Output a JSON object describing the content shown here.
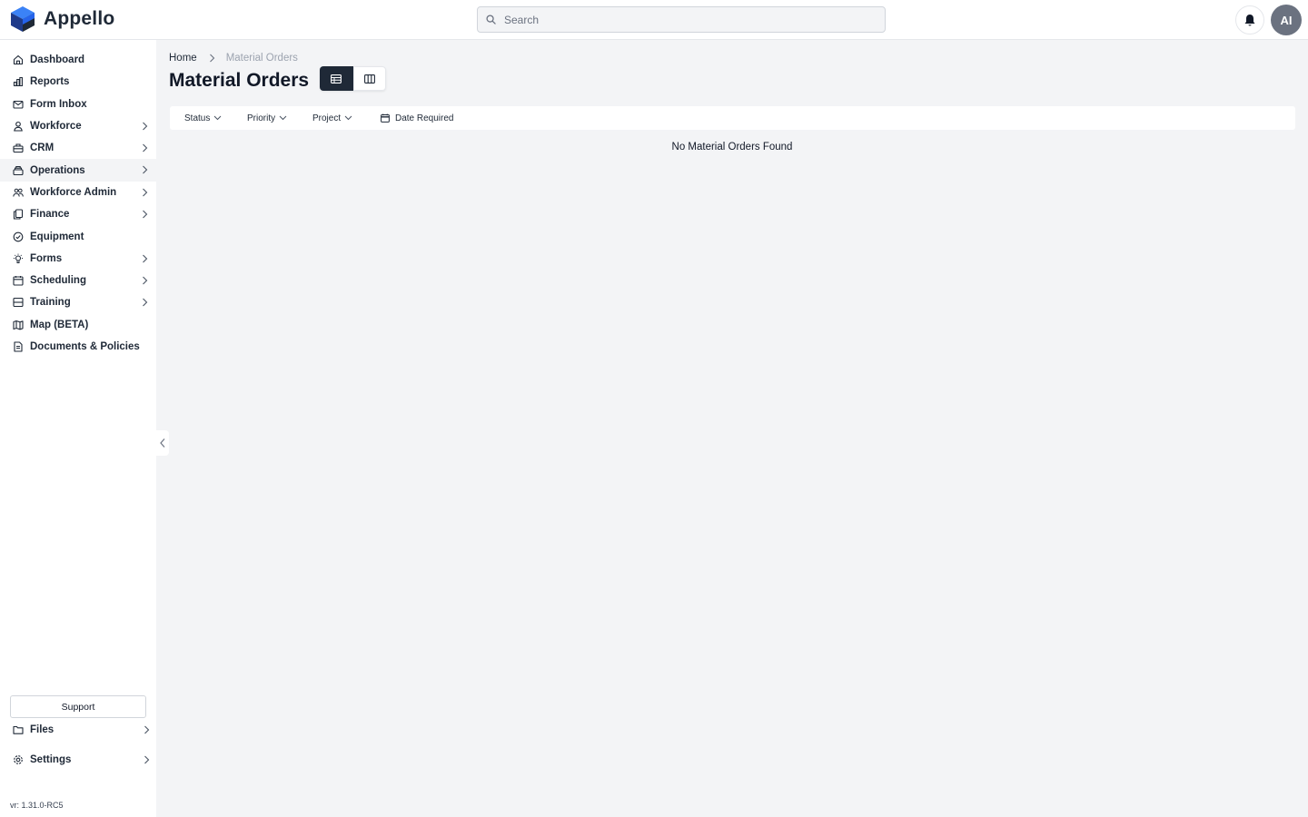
{
  "app": {
    "name": "Appello"
  },
  "search": {
    "placeholder": "Search"
  },
  "user": {
    "initials": "AI"
  },
  "sidebar": {
    "items": [
      {
        "label": "Dashboard",
        "icon": "home-icon",
        "has_submenu": false
      },
      {
        "label": "Reports",
        "icon": "chart-icon",
        "has_submenu": false
      },
      {
        "label": "Form Inbox",
        "icon": "mail-icon",
        "has_submenu": false
      },
      {
        "label": "Workforce",
        "icon": "user-icon",
        "has_submenu": true
      },
      {
        "label": "CRM",
        "icon": "briefcase-icon",
        "has_submenu": true
      },
      {
        "label": "Operations",
        "icon": "stack-icon",
        "has_submenu": true,
        "active": true
      },
      {
        "label": "Workforce Admin",
        "icon": "users-icon",
        "has_submenu": true
      },
      {
        "label": "Finance",
        "icon": "documents-icon",
        "has_submenu": true
      },
      {
        "label": "Equipment",
        "icon": "check-circle-icon",
        "has_submenu": false
      },
      {
        "label": "Forms",
        "icon": "lightbulb-icon",
        "has_submenu": true
      },
      {
        "label": "Scheduling",
        "icon": "calendar-icon",
        "has_submenu": true
      },
      {
        "label": "Training",
        "icon": "server-icon",
        "has_submenu": true
      },
      {
        "label": "Map (BETA)",
        "icon": "map-icon",
        "has_submenu": false
      },
      {
        "label": "Documents & Policies",
        "icon": "document-icon",
        "has_submenu": false
      }
    ],
    "support_label": "Support",
    "files_label": "Files",
    "settings_label": "Settings",
    "version": "vr: 1.31.0-RC5"
  },
  "breadcrumb": {
    "home": "Home",
    "current": "Material Orders"
  },
  "page": {
    "title": "Material Orders",
    "empty_message": "No Material Orders Found",
    "active_view": "table"
  },
  "filters": {
    "status": "Status",
    "priority": "Priority",
    "project": "Project",
    "date_required": "Date Required"
  },
  "colors": {
    "brand_blue": "#3b82f6",
    "brand_dark": "#1e3a8a",
    "active_toggle": "#1f2937",
    "background": "#f3f4f6"
  }
}
